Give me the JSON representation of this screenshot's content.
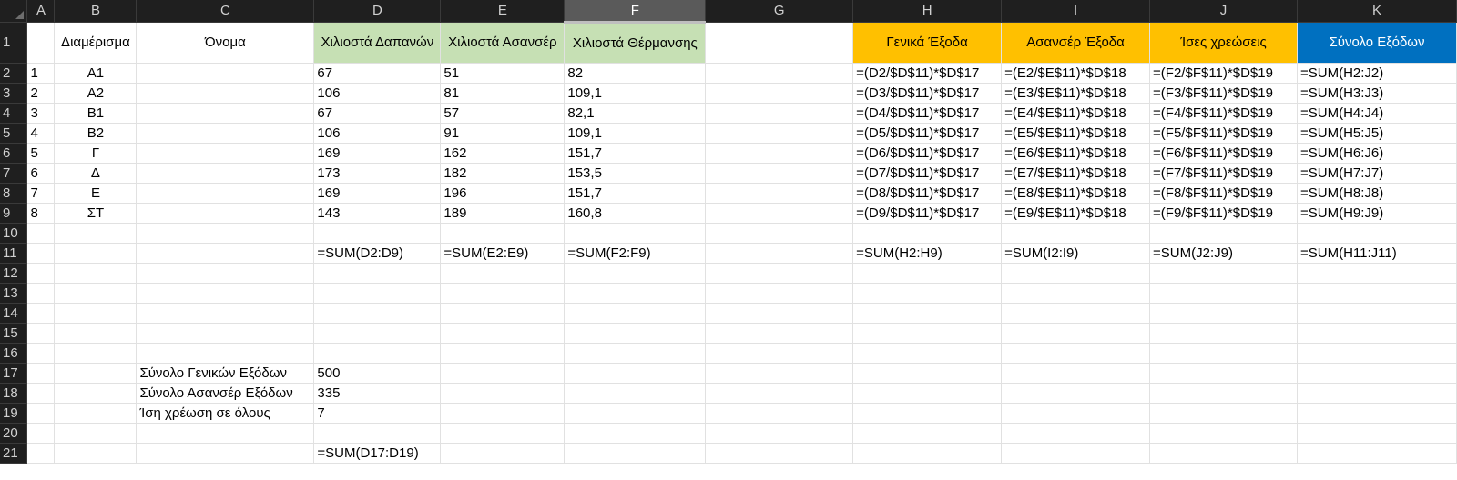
{
  "columns": [
    "A",
    "B",
    "C",
    "D",
    "E",
    "F",
    "G",
    "H",
    "I",
    "J",
    "K"
  ],
  "selected_column": "F",
  "rows": [
    {
      "n": "1",
      "cells": [
        "",
        "Διαμέρισμα",
        "Όνομα",
        "Χιλιοστά Δαπανών",
        "Χιλιοστά Ασανσέρ",
        "Χιλιοστά Θέρμανσης",
        "",
        "Γενικά Έξοδα",
        "Ασανσέρ Έξοδα",
        "Ίσες χρεώσεις",
        "Σύνολο Εξόδων"
      ]
    },
    {
      "n": "2",
      "cells": [
        "1",
        "Α1",
        "",
        "67",
        "51",
        "82",
        "",
        "=(D2/$D$11)*$D$17",
        "=(E2/$E$11)*$D$18",
        "=(F2/$F$11)*$D$19",
        "=SUM(H2:J2)"
      ]
    },
    {
      "n": "3",
      "cells": [
        "2",
        "Α2",
        "",
        "106",
        "81",
        "109,1",
        "",
        "=(D3/$D$11)*$D$17",
        "=(E3/$E$11)*$D$18",
        "=(F3/$F$11)*$D$19",
        "=SUM(H3:J3)"
      ]
    },
    {
      "n": "4",
      "cells": [
        "3",
        "Β1",
        "",
        "67",
        "57",
        "82,1",
        "",
        "=(D4/$D$11)*$D$17",
        "=(E4/$E$11)*$D$18",
        "=(F4/$F$11)*$D$19",
        "=SUM(H4:J4)"
      ]
    },
    {
      "n": "5",
      "cells": [
        "4",
        "Β2",
        "",
        "106",
        "91",
        "109,1",
        "",
        "=(D5/$D$11)*$D$17",
        "=(E5/$E$11)*$D$18",
        "=(F5/$F$11)*$D$19",
        "=SUM(H5:J5)"
      ]
    },
    {
      "n": "6",
      "cells": [
        "5",
        "Γ",
        "",
        "169",
        "162",
        "151,7",
        "",
        "=(D6/$D$11)*$D$17",
        "=(E6/$E$11)*$D$18",
        "=(F6/$F$11)*$D$19",
        "=SUM(H6:J6)"
      ]
    },
    {
      "n": "7",
      "cells": [
        "6",
        "Δ",
        "",
        "173",
        "182",
        "153,5",
        "",
        "=(D7/$D$11)*$D$17",
        "=(E7/$E$11)*$D$18",
        "=(F7/$F$11)*$D$19",
        "=SUM(H7:J7)"
      ]
    },
    {
      "n": "8",
      "cells": [
        "7",
        "Ε",
        "",
        "169",
        "196",
        "151,7",
        "",
        "=(D8/$D$11)*$D$17",
        "=(E8/$E$11)*$D$18",
        "=(F8/$F$11)*$D$19",
        "=SUM(H8:J8)"
      ]
    },
    {
      "n": "9",
      "cells": [
        "8",
        "ΣΤ",
        "",
        "143",
        "189",
        "160,8",
        "",
        "=(D9/$D$11)*$D$17",
        "=(E9/$E$11)*$D$18",
        "=(F9/$F$11)*$D$19",
        "=SUM(H9:J9)"
      ]
    },
    {
      "n": "10",
      "cells": [
        "",
        "",
        "",
        "",
        "",
        "",
        "",
        "",
        "",
        "",
        ""
      ]
    },
    {
      "n": "11",
      "cells": [
        "",
        "",
        "",
        "=SUM(D2:D9)",
        "=SUM(E2:E9)",
        "=SUM(F2:F9)",
        "",
        "=SUM(H2:H9)",
        "=SUM(I2:I9)",
        "=SUM(J2:J9)",
        "=SUM(H11:J11)"
      ]
    },
    {
      "n": "12",
      "cells": [
        "",
        "",
        "",
        "",
        "",
        "",
        "",
        "",
        "",
        "",
        ""
      ]
    },
    {
      "n": "13",
      "cells": [
        "",
        "",
        "",
        "",
        "",
        "",
        "",
        "",
        "",
        "",
        ""
      ]
    },
    {
      "n": "14",
      "cells": [
        "",
        "",
        "",
        "",
        "",
        "",
        "",
        "",
        "",
        "",
        ""
      ]
    },
    {
      "n": "15",
      "cells": [
        "",
        "",
        "",
        "",
        "",
        "",
        "",
        "",
        "",
        "",
        ""
      ]
    },
    {
      "n": "16",
      "cells": [
        "",
        "",
        "",
        "",
        "",
        "",
        "",
        "",
        "",
        "",
        ""
      ]
    },
    {
      "n": "17",
      "cells": [
        "",
        "",
        "Σύνολο Γενικών Εξόδων",
        "500",
        "",
        "",
        "",
        "",
        "",
        "",
        ""
      ]
    },
    {
      "n": "18",
      "cells": [
        "",
        "",
        "Σύνολο Ασανσέρ Εξόδων",
        "335",
        "",
        "",
        "",
        "",
        "",
        "",
        ""
      ]
    },
    {
      "n": "19",
      "cells": [
        "",
        "",
        "Ίση χρέωση σε όλους",
        "7",
        "",
        "",
        "",
        "",
        "",
        "",
        ""
      ]
    },
    {
      "n": "20",
      "cells": [
        "",
        "",
        "",
        "",
        "",
        "",
        "",
        "",
        "",
        "",
        ""
      ]
    },
    {
      "n": "21",
      "cells": [
        "",
        "",
        "",
        "=SUM(D17:D19)",
        "",
        "",
        "",
        "",
        "",
        "",
        ""
      ]
    }
  ],
  "colors": {
    "header_green": "#c6e0b4",
    "header_orange": "#ffc000",
    "header_blue": "#0070c0",
    "chrome_dark": "#1f1f1f"
  }
}
